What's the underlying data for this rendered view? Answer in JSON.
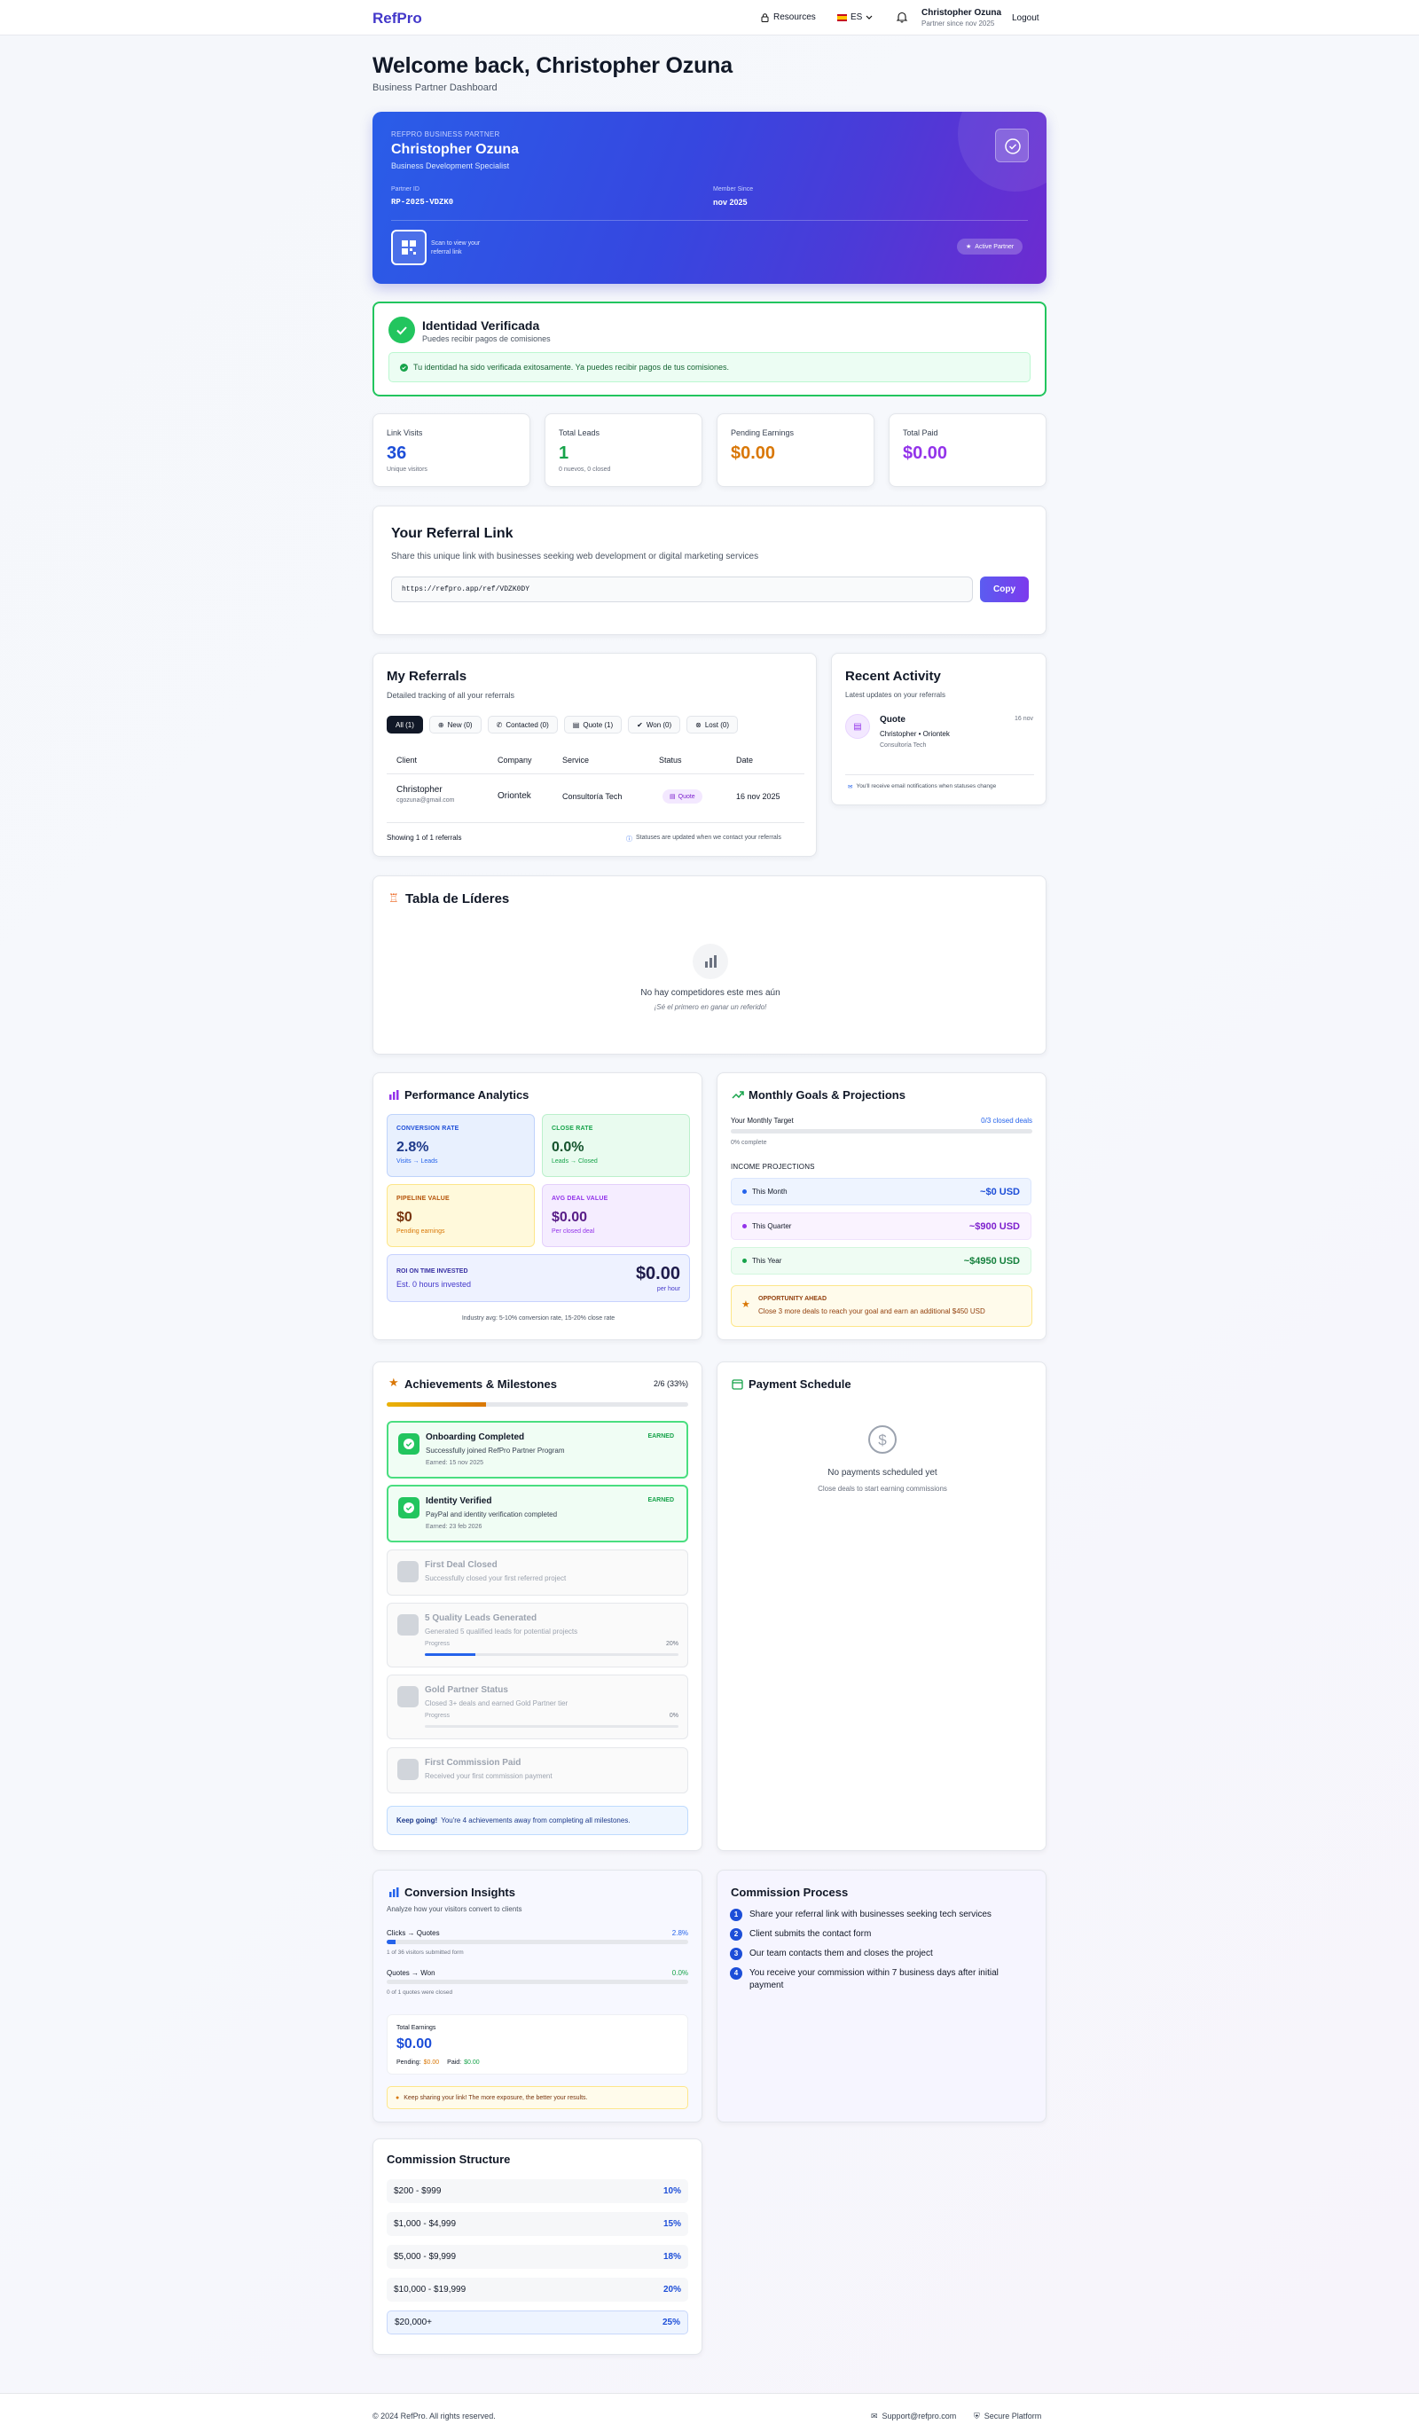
{
  "brand": "RefPro",
  "nav": {
    "resources": "Resources",
    "lang": "ES",
    "user_name": "Christopher Ozuna",
    "user_sub": "Partner since nov 2025",
    "logout": "Logout"
  },
  "welcome": {
    "title": "Welcome back, Christopher Ozuna",
    "subtitle": "Business Partner Dashboard"
  },
  "hero": {
    "label": "REFPRO BUSINESS PARTNER",
    "name": "Christopher Ozuna",
    "role": "Business Development Specialist",
    "partner_id_label": "Partner ID",
    "partner_id": "RP-2025-VDZK0",
    "member_label": "Member Since",
    "member_since": "nov 2025",
    "qr_text": "Scan to view your referral link",
    "badge": "Active Partner"
  },
  "verify": {
    "title": "Identidad Verificada",
    "subtitle": "Puedes recibir pagos de comisiones",
    "message": "Tu identidad ha sido verificada exitosamente. Ya puedes recibir pagos de tus comisiones."
  },
  "stats": [
    {
      "label": "Link Visits",
      "value": "36",
      "sub": "Unique visitors",
      "color": "#1d4ed8"
    },
    {
      "label": "Total Leads",
      "value": "1",
      "sub": "0 nuevos, 0 closed",
      "color": "#16a34a"
    },
    {
      "label": "Pending Earnings",
      "value": "$0.00",
      "sub": "",
      "color": "#d97706"
    },
    {
      "label": "Total Paid",
      "value": "$0.00",
      "sub": "",
      "color": "#9333ea"
    }
  ],
  "referral": {
    "title": "Your Referral Link",
    "desc": "Share this unique link with businesses seeking web development or digital marketing services",
    "url": "https://refpro.app/ref/VDZK0DY",
    "copy": "Copy"
  },
  "referrals": {
    "title": "My Referrals",
    "subtitle": "Detailed tracking of all your referrals",
    "tabs": [
      "All (1)",
      "New (0)",
      "Contacted (0)",
      "Quote (1)",
      "Won (0)",
      "Lost (0)"
    ],
    "columns": [
      "Client",
      "Company",
      "Service",
      "Status",
      "Date"
    ],
    "row": {
      "client": "Christopher",
      "email": "cgozuna@gmail.com",
      "company": "Oriontek",
      "service": "Consultoría Tech",
      "status": "Quote",
      "date": "16 nov 2025"
    },
    "showing": "Showing 1 of 1 referrals",
    "note": "Statuses are updated when we contact your referrals"
  },
  "activity": {
    "title": "Recent Activity",
    "subtitle": "Latest updates on your referrals",
    "item_title": "Quote",
    "item_date": "16 nov",
    "item_who": "Christopher • Oriontek",
    "item_service": "Consultoría Tech",
    "note": "You'll receive email notifications when statuses change"
  },
  "leaders": {
    "title": "Tabla de Líderes",
    "empty": "No hay competidores este mes aún",
    "cta": "¡Sé el primero en ganar un referido!"
  },
  "analytics": {
    "title": "Performance Analytics",
    "conv_label": "CONVERSION RATE",
    "conv": "2.8%",
    "conv_sub": "Visits → Leads",
    "close_label": "CLOSE RATE",
    "close": "0.0%",
    "close_sub": "Leads → Closed",
    "pipe_label": "PIPELINE VALUE",
    "pipe": "$0",
    "pipe_sub": "Pending earnings",
    "deal_label": "AVG DEAL VALUE",
    "deal": "$0.00",
    "deal_sub": "Per closed deal",
    "roi_label": "ROI ON TIME INVESTED",
    "roi_sub": "Est. 0 hours invested",
    "roi": "$0.00",
    "roi_unit": "per hour",
    "footnote": "Industry avg: 5-10% conversion rate, 15-20% close rate"
  },
  "goals": {
    "title": "Monthly Goals & Projections",
    "target_label": "Your Monthly Target",
    "target_val": "0/3 closed deals",
    "target_progress": 0,
    "complete": "0% complete",
    "proj_title": "INCOME PROJECTIONS",
    "projections": [
      {
        "label": "This Month",
        "value": "~$0 USD"
      },
      {
        "label": "This Quarter",
        "value": "~$900 USD"
      },
      {
        "label": "This Year",
        "value": "~$4950 USD"
      }
    ],
    "opp_title": "OPPORTUNITY AHEAD",
    "opp_text": "Close 3 more deals to reach your goal and earn an additional $450 USD"
  },
  "achievements": {
    "title": "Achievements & Milestones",
    "count": "2/6 (33%)",
    "progress": 0.33,
    "items": [
      {
        "title": "Onboarding Completed",
        "desc": "Successfully joined RefPro Partner Program",
        "meta": "Earned: 15 nov 2025",
        "earned": "EARNED"
      },
      {
        "title": "Identity Verified",
        "desc": "PayPal and identity verification completed",
        "meta": "Earned: 23 feb 2026",
        "earned": "EARNED"
      },
      {
        "title": "First Deal Closed",
        "desc": "Successfully closed your first referred project"
      },
      {
        "title": "5 Quality Leads Generated",
        "desc": "Generated 5 qualified leads for potential projects",
        "progress_label": "Progress",
        "progress_text": "20%",
        "progress": 0.2
      },
      {
        "title": "Gold Partner Status",
        "desc": "Closed 3+ deals and earned Gold Partner tier",
        "progress_label": "Progress",
        "progress_text": "0%",
        "progress": 0
      },
      {
        "title": "First Commission Paid",
        "desc": "Received your first commission payment"
      }
    ],
    "footer_bold": "Keep going!",
    "footer_text": "You're 4 achievements away from completing all milestones."
  },
  "payments": {
    "title": "Payment Schedule",
    "empty": "No payments scheduled yet",
    "hint": "Close deals to start earning commissions"
  },
  "insights": {
    "title": "Conversion Insights",
    "subtitle": "Analyze how your visitors convert to clients",
    "c1_label": "Clicks → Quotes",
    "c1_val": "2.8%",
    "c1_progress": 0.028,
    "c1_sub": "1 of 36 visitors submitted form",
    "c2_label": "Quotes → Won",
    "c2_val": "0.0%",
    "c2_progress": 0,
    "c2_sub": "0 of 1 quotes were closed",
    "earn_label": "Total Earnings",
    "earn": "$0.00",
    "pending_label": "Pending:",
    "pending": "$0.00",
    "paid_label": "Paid:",
    "paid": "$0.00",
    "tip": "Keep sharing your link! The more exposure, the better your results."
  },
  "process": {
    "title": "Commission Process",
    "steps": [
      "Share your referral link with businesses seeking tech services",
      "Client submits the contact form",
      "Our team contacts them and closes the project",
      "You receive your commission within 7 business days after initial payment"
    ]
  },
  "commission": {
    "title": "Commission Structure",
    "tiers": [
      {
        "range": "$200 - $999",
        "rate": "10%"
      },
      {
        "range": "$1,000 - $4,999",
        "rate": "15%"
      },
      {
        "range": "$5,000 - $9,999",
        "rate": "18%"
      },
      {
        "range": "$10,000 - $19,999",
        "rate": "20%"
      },
      {
        "range": "$20,000+",
        "rate": "25%"
      }
    ]
  },
  "footer": {
    "copyright": "© 2024 RefPro. All rights reserved.",
    "support": "Support@refpro.com",
    "secure": "Secure Platform"
  },
  "colors": {
    "brand": "#4338ca",
    "success": "#22c55e",
    "primary": "#1d4ed8",
    "purple": "#9333ea",
    "amber": "#d97706"
  }
}
